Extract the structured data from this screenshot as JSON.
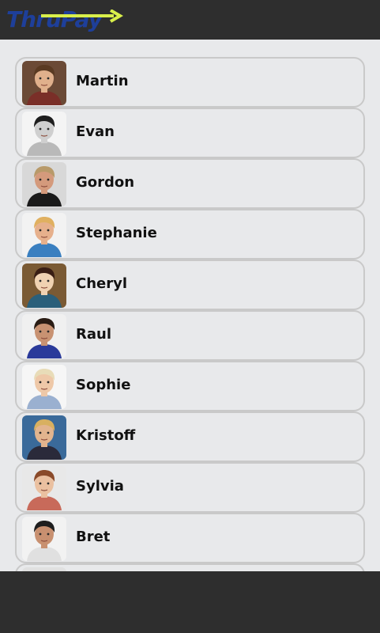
{
  "app": {
    "logo_text": "ThruPay",
    "logo_color": "#1e3f9a",
    "arrow_color": "#d9ef4a"
  },
  "contacts": [
    {
      "name": "Martin",
      "avatar": "martin-avatar",
      "colors": {
        "bg": "#6b4a36",
        "skin": "#e0b08c",
        "hair": "#5a3a22",
        "shirt": "#7a2f28"
      }
    },
    {
      "name": "Evan",
      "avatar": "evan-avatar",
      "colors": {
        "bg": "#f4f4f4",
        "skin": "#cfcfcf",
        "hair": "#1e1e1e",
        "shirt": "#b9b9b9"
      }
    },
    {
      "name": "Gordon",
      "avatar": "gordon-avatar",
      "colors": {
        "bg": "#d8d8d8",
        "skin": "#d49a7c",
        "hair": "#b89a6a",
        "shirt": "#1a1a1a"
      }
    },
    {
      "name": "Stephanie",
      "avatar": "stephanie-avatar",
      "colors": {
        "bg": "#f2f2f2",
        "skin": "#e6b08c",
        "hair": "#e0b060",
        "shirt": "#3a7fc0"
      }
    },
    {
      "name": "Cheryl",
      "avatar": "cheryl-avatar",
      "colors": {
        "bg": "#7a5a34",
        "skin": "#f0d2b2",
        "hair": "#3a1e14",
        "shirt": "#2a5f7a"
      }
    },
    {
      "name": "Raul",
      "avatar": "raul-avatar",
      "colors": {
        "bg": "#f0f0f0",
        "skin": "#c89272",
        "hair": "#2a1c14",
        "shirt": "#2a3a9a"
      }
    },
    {
      "name": "Sophie",
      "avatar": "sophie-avatar",
      "colors": {
        "bg": "#f6f6f6",
        "skin": "#eec8a8",
        "hair": "#e8dcb8",
        "shirt": "#9ab0d0"
      }
    },
    {
      "name": "Kristoff",
      "avatar": "kristoff-avatar",
      "colors": {
        "bg": "#3a6a9a",
        "skin": "#e2b48e",
        "hair": "#d8b060",
        "shirt": "#2a2a3a"
      }
    },
    {
      "name": "Sylvia",
      "avatar": "sylvia-avatar",
      "colors": {
        "bg": "#e8e8e8",
        "skin": "#eac0a0",
        "hair": "#8a4a2a",
        "shirt": "#c86a5a"
      }
    },
    {
      "name": "Bret",
      "avatar": "bret-avatar",
      "colors": {
        "bg": "#f2f2f2",
        "skin": "#c89070",
        "hair": "#1e1e1e",
        "shirt": "#e0e0e0"
      }
    },
    {
      "name": "",
      "avatar": "partial-avatar",
      "colors": {
        "bg": "#e0e0e0",
        "skin": "#c09070",
        "hair": "#1a1a1a",
        "shirt": "#cccccc"
      }
    }
  ]
}
